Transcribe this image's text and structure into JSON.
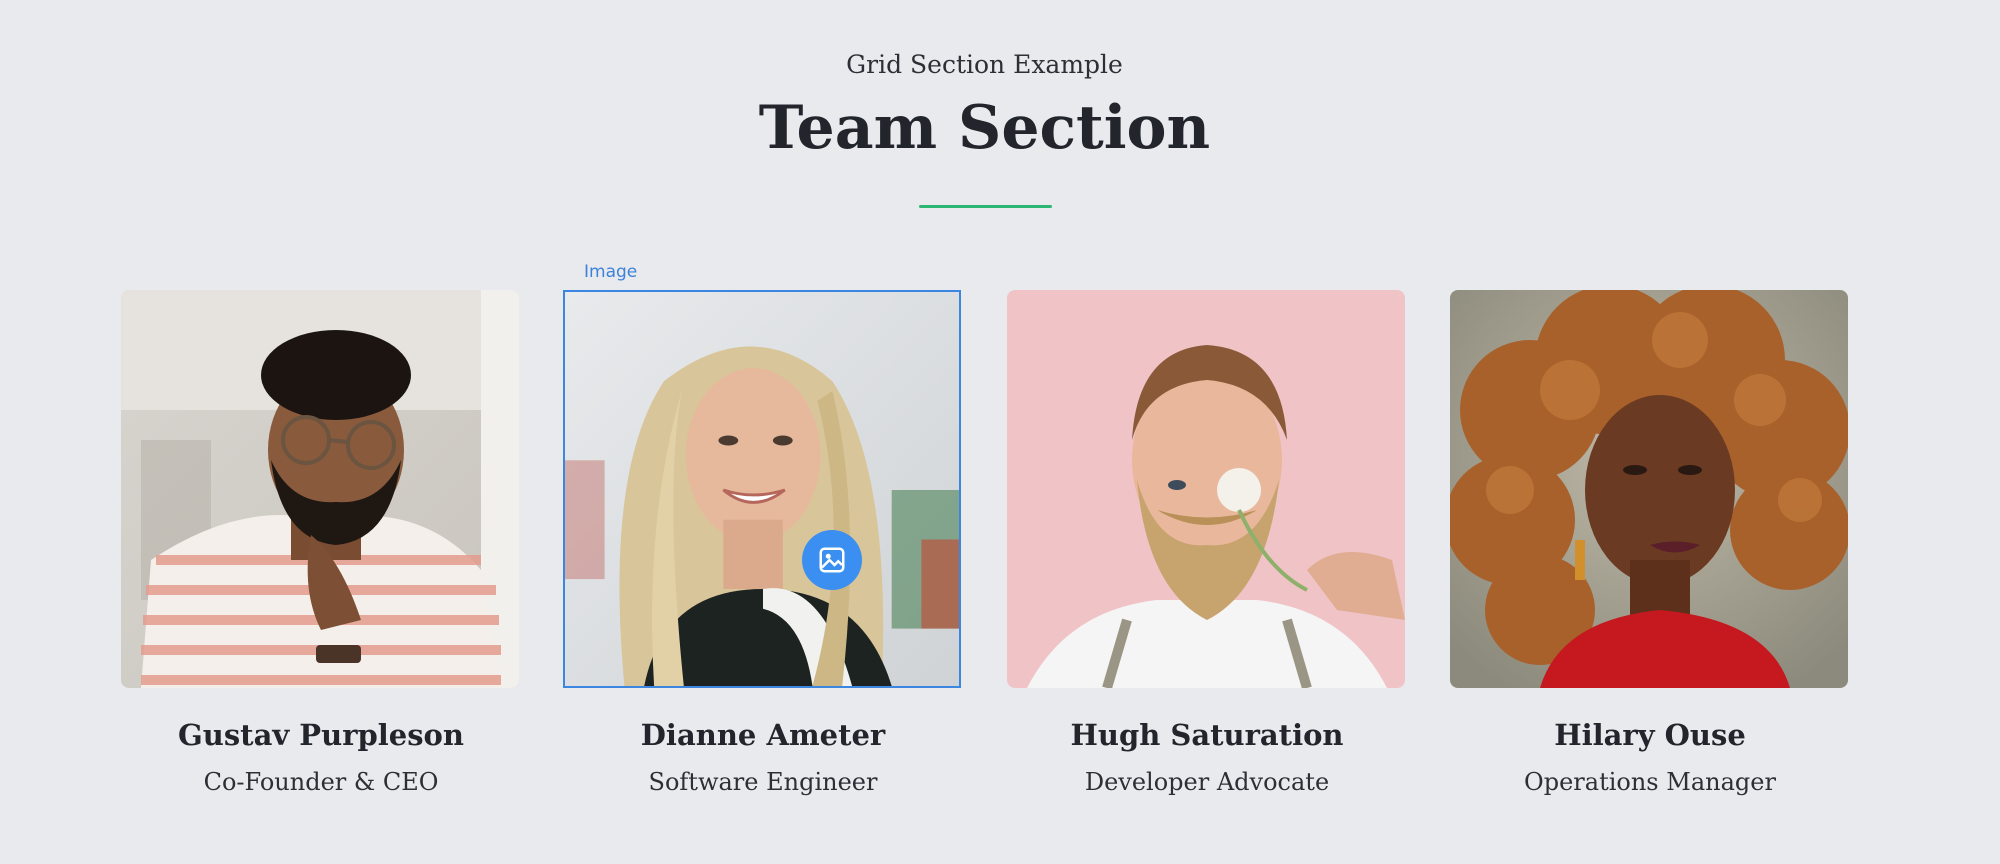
{
  "header": {
    "kicker": "Grid Section Example",
    "title": "Team Section"
  },
  "editor": {
    "selected_label": "Image",
    "accent_color": "#3b86e0",
    "badge_icon": "image-icon"
  },
  "accent_line_color": "#2bb673",
  "team": [
    {
      "name": "Gustav Purpleson",
      "role": "Co-Founder & CEO"
    },
    {
      "name": "Dianne Ameter",
      "role": "Software Engineer"
    },
    {
      "name": "Hugh Saturation",
      "role": "Developer Advocate"
    },
    {
      "name": "Hilary Ouse",
      "role": "Operations Manager"
    }
  ]
}
